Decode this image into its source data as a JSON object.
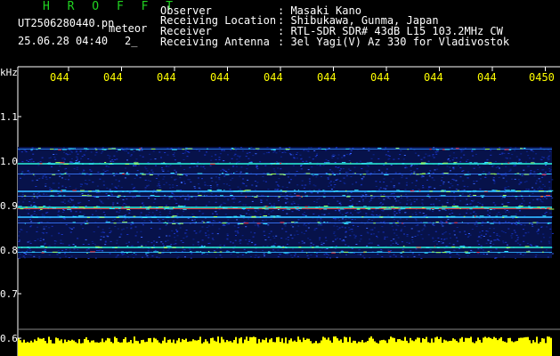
{
  "header": {
    "brand": "H R O F F T",
    "filename": "UT2506280440.pn",
    "mode": "meteor",
    "datetime": "25.06.28 04:40",
    "page": "2_",
    "fields": [
      {
        "label": "Observer",
        "value": ": Masaki Kano"
      },
      {
        "label": "Receiving Location",
        "value": ": Shibukawa, Gunma, Japan"
      },
      {
        "label": "Receiver",
        "value": ": RTL-SDR SDR# 43dB L15 103.2MHz CW"
      },
      {
        "label": "Receiving Antenna",
        "value": ": 3el Yagi(V) Az 330 for Vladivostok"
      }
    ]
  },
  "x_axis": {
    "ticks": [
      "044",
      "044",
      "044",
      "044",
      "044",
      "044",
      "044",
      "044",
      "044",
      "0450"
    ]
  },
  "y_axis": {
    "unit": "kHz",
    "ticks": [
      "1.1",
      "1.0",
      "0.9",
      "0.8",
      "0.7",
      "0.6"
    ]
  },
  "colors": {
    "background": "#000000",
    "noise": "#1a35c8",
    "band": "#27d9c8",
    "signal": "#ff2a2a",
    "power_bar": "#ffff00",
    "brand": "#21d321",
    "tick_label": "#ffff00"
  }
}
